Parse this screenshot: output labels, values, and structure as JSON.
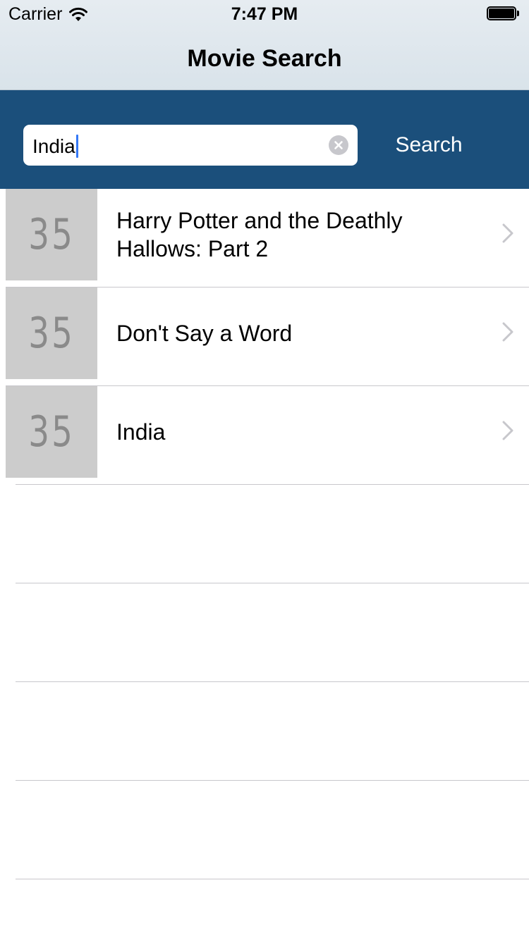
{
  "status_bar": {
    "carrier": "Carrier",
    "time": "7:47 PM"
  },
  "nav": {
    "title": "Movie Search"
  },
  "search": {
    "value": "India",
    "button_label": "Search"
  },
  "results": [
    {
      "poster_text": "35",
      "title": "Harry Potter and the Deathly Hallows: Part 2"
    },
    {
      "poster_text": "35",
      "title": "Don't Say a Word"
    },
    {
      "poster_text": "35",
      "title": "India"
    }
  ],
  "colors": {
    "search_band": "#1b4f7b",
    "poster_placeholder": "#cccccc",
    "caret": "#3478f6"
  },
  "icons": [
    "wifi-icon",
    "battery-icon",
    "clear-text-icon",
    "chevron-right-icon"
  ]
}
